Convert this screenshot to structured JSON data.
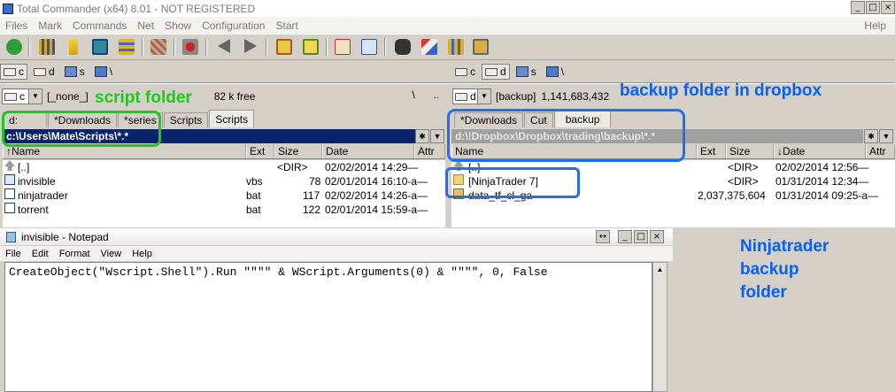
{
  "window": {
    "title": "Total Commander (x64) 8.01 - NOT REGISTERED"
  },
  "menu": {
    "items": [
      "Files",
      "Mark",
      "Commands",
      "Net",
      "Show",
      "Configuration",
      "Start"
    ],
    "help": "Help"
  },
  "left": {
    "drives": [
      "c",
      "d",
      "s",
      "\\"
    ],
    "drive_combo": "c",
    "volume_label": "[_none_]",
    "free_space": "82 k free",
    "path_btns": [
      "\\",
      ".."
    ],
    "tabs": [
      "d:",
      "*Downloads",
      "*series",
      "Scripts",
      "Scripts"
    ],
    "current_path": "c:\\Users\\Mate\\Scripts\\*.*",
    "columns": {
      "name": "Name",
      "ext": "Ext",
      "size": "Size",
      "date": "Date",
      "attr": "Attr"
    },
    "files": [
      {
        "name": "[..]",
        "ext": "",
        "size": "<DIR>",
        "date": "02/02/2014 14:29—",
        "icon": "up-dir-icon"
      },
      {
        "name": "invisible",
        "ext": "vbs",
        "size": "78",
        "date": "02/01/2014 16:10-a—",
        "icon": "vbs-file-icon"
      },
      {
        "name": "ninjatrader",
        "ext": "bat",
        "size": "117",
        "date": "02/02/2014 14:26-a—",
        "icon": "bat-file-icon"
      },
      {
        "name": "torrent",
        "ext": "bat",
        "size": "122",
        "date": "02/01/2014 15:59-a—",
        "icon": "bat-file-icon"
      }
    ]
  },
  "right": {
    "drives": [
      "c",
      "d",
      "s",
      "\\"
    ],
    "drive_combo": "d",
    "volume_label": "[backup]",
    "free_space": "1,141,683,432",
    "tabs": [
      "*Downloads",
      "Cut",
      "backup"
    ],
    "current_path": "d:\\!Dropbox\\Dropbox\\trading\\backup\\*.*",
    "columns": {
      "name": "Name",
      "ext": "Ext",
      "size": "Size",
      "date": "Date",
      "attr": "Attr"
    },
    "files": [
      {
        "name": "[..]",
        "ext": "",
        "size": "<DIR>",
        "date": "02/02/2014 12:56—",
        "icon": "up-dir-icon"
      },
      {
        "name": "[NinjaTrader 7]",
        "ext": "",
        "size": "<DIR>",
        "date": "01/31/2014 12:34—",
        "icon": "folder-icon"
      },
      {
        "name": "data_tf_cl_ga",
        "ext": "",
        "size": "2,037,375,604",
        "date": "01/31/2014 09:25-a—",
        "icon": "file-icon"
      }
    ]
  },
  "notepad": {
    "title": "invisible - Notepad",
    "menu": [
      "File",
      "Edit",
      "Format",
      "View",
      "Help"
    ],
    "content": "CreateObject(\"Wscript.Shell\").Run \"\"\"\" & WScript.Arguments(0) & \"\"\"\", 0, False"
  },
  "annotations": {
    "script_folder": "script folder",
    "backup_folder": "backup folder in dropbox",
    "ninjatrader_backup": [
      "Ninjatrader",
      "backup",
      "folder"
    ]
  },
  "colors": {
    "active_path": "#0a246a",
    "annotation_blue": "#1f6ff0",
    "annotation_green": "#1ec81e"
  }
}
